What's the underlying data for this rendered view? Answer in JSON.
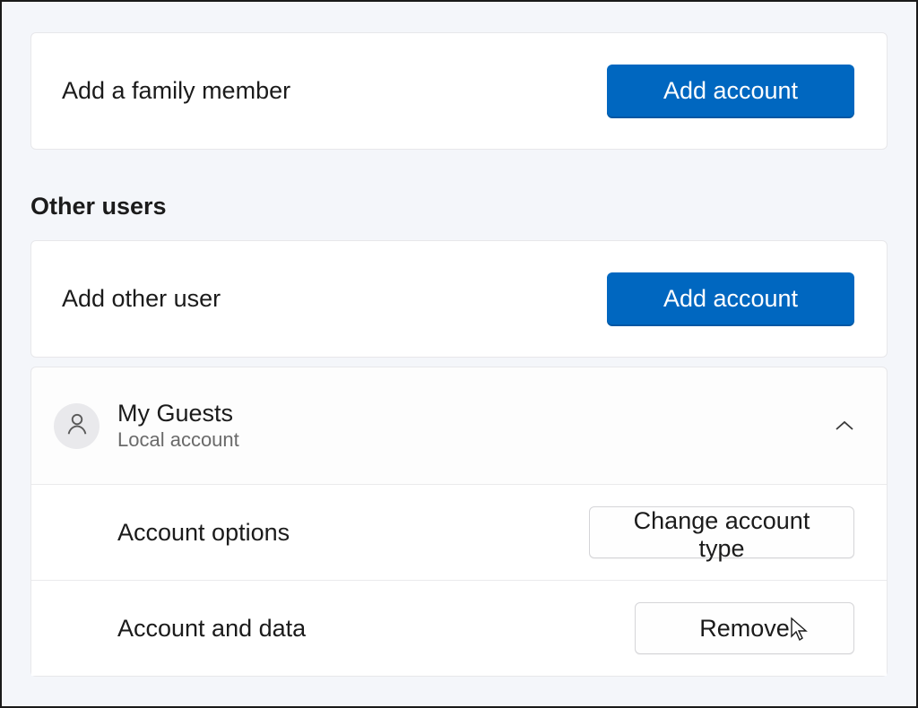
{
  "family": {
    "label": "Add a family member",
    "button": "Add account"
  },
  "other_users": {
    "heading": "Other users",
    "add_label": "Add other user",
    "add_button": "Add account",
    "users": [
      {
        "name": "My Guests",
        "type": "Local account",
        "expanded": true,
        "options": {
          "account_options_label": "Account options",
          "change_type_button": "Change account type",
          "account_data_label": "Account and data",
          "remove_button": "Remove"
        }
      }
    ]
  },
  "colors": {
    "primary": "#0067c0",
    "background": "#f4f6fa",
    "card": "#ffffff",
    "border": "#e7e7ea",
    "text": "#1b1b1b",
    "subtext": "#6a6a6a"
  }
}
